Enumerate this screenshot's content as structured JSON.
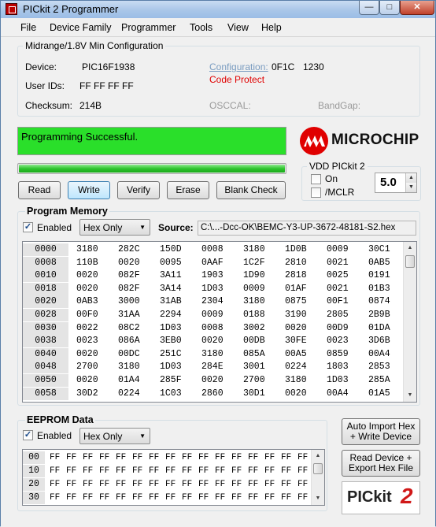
{
  "window": {
    "title": "PICkit 2 Programmer"
  },
  "menu": [
    "File",
    "Device Family",
    "Programmer",
    "Tools",
    "View",
    "Help"
  ],
  "config": {
    "group_title": "Midrange/1.8V Min Configuration",
    "device_label": "Device:",
    "device_value": "PIC16F1938",
    "userids_label": "User IDs:",
    "userids_value": "FF FF FF FF",
    "checksum_label": "Checksum:",
    "checksum_value": "214B",
    "configuration_label": "Configuration:",
    "configuration_values": [
      "0F1C",
      "1230"
    ],
    "code_protect": "Code Protect",
    "osccal_label": "OSCCAL:",
    "bandgap_label": "BandGap:"
  },
  "status": {
    "message": "Programming Successful.",
    "status_color": "#2adf2a",
    "progress": 1.0
  },
  "actions": [
    "Read",
    "Write",
    "Verify",
    "Erase",
    "Blank Check"
  ],
  "logo": {
    "text": "MICROCHIP",
    "brand_color": "#e00000"
  },
  "vdd": {
    "group_title": "VDD PICkit 2",
    "on_label": "On",
    "mclr_label": "/MCLR",
    "voltage": "5.0"
  },
  "program_memory": {
    "title": "Program Memory",
    "enabled_label": "Enabled",
    "mode": "Hex Only",
    "source_label": "Source:",
    "source_value": "C:\\...-Dcc-OK\\BEMC-Y3-UP-3672-48181-S2.hex",
    "rows": [
      {
        "addr": "0000",
        "cells": [
          "3180",
          "282C",
          "150D",
          "0008",
          "3180",
          "1D0B",
          "0009",
          "30C1"
        ]
      },
      {
        "addr": "0008",
        "cells": [
          "110B",
          "0020",
          "0095",
          "0AAF",
          "1C2F",
          "2810",
          "0021",
          "0AB5"
        ]
      },
      {
        "addr": "0010",
        "cells": [
          "0020",
          "082F",
          "3A11",
          "1903",
          "1D90",
          "2818",
          "0025",
          "0191"
        ]
      },
      {
        "addr": "0018",
        "cells": [
          "0020",
          "082F",
          "3A14",
          "1D03",
          "0009",
          "01AF",
          "0021",
          "01B3"
        ]
      },
      {
        "addr": "0020",
        "cells": [
          "0AB3",
          "3000",
          "31AB",
          "2304",
          "3180",
          "0875",
          "00F1",
          "0874"
        ]
      },
      {
        "addr": "0028",
        "cells": [
          "00F0",
          "31AA",
          "2294",
          "0009",
          "0188",
          "3190",
          "2805",
          "2B9B"
        ]
      },
      {
        "addr": "0030",
        "cells": [
          "0022",
          "08C2",
          "1D03",
          "0008",
          "3002",
          "0020",
          "00D9",
          "01DA"
        ]
      },
      {
        "addr": "0038",
        "cells": [
          "0023",
          "086A",
          "3EB0",
          "0020",
          "00DB",
          "30FE",
          "0023",
          "3D6B"
        ]
      },
      {
        "addr": "0040",
        "cells": [
          "0020",
          "00DC",
          "251C",
          "3180",
          "085A",
          "00A5",
          "0859",
          "00A4"
        ]
      },
      {
        "addr": "0048",
        "cells": [
          "2700",
          "3180",
          "1D03",
          "284E",
          "3001",
          "0224",
          "1803",
          "2853"
        ]
      },
      {
        "addr": "0050",
        "cells": [
          "0020",
          "01A4",
          "285F",
          "0020",
          "2700",
          "3180",
          "1D03",
          "285A"
        ]
      },
      {
        "addr": "0058",
        "cells": [
          "30D2",
          "0224",
          "1C03",
          "2860",
          "30D1",
          "0020",
          "00A4",
          "01A5"
        ]
      }
    ]
  },
  "eeprom": {
    "title": "EEPROM Data",
    "enabled_label": "Enabled",
    "mode": "Hex Only",
    "rows": [
      {
        "addr": "00",
        "bytes": [
          "FF",
          "FF",
          "FF",
          "FF",
          "FF",
          "FF",
          "FF",
          "FF",
          "FF",
          "FF",
          "FF",
          "FF",
          "FF",
          "FF",
          "FF",
          "FF"
        ]
      },
      {
        "addr": "10",
        "bytes": [
          "FF",
          "FF",
          "FF",
          "FF",
          "FF",
          "FF",
          "FF",
          "FF",
          "FF",
          "FF",
          "FF",
          "FF",
          "FF",
          "FF",
          "FF",
          "FF"
        ]
      },
      {
        "addr": "20",
        "bytes": [
          "FF",
          "FF",
          "FF",
          "FF",
          "FF",
          "FF",
          "FF",
          "FF",
          "FF",
          "FF",
          "FF",
          "FF",
          "FF",
          "FF",
          "FF",
          "FF"
        ]
      },
      {
        "addr": "30",
        "bytes": [
          "FF",
          "FF",
          "FF",
          "FF",
          "FF",
          "FF",
          "FF",
          "FF",
          "FF",
          "FF",
          "FF",
          "FF",
          "FF",
          "FF",
          "FF",
          "FF"
        ]
      }
    ],
    "auto_import_label_1": "Auto Import Hex",
    "auto_import_label_2": "+ Write Device",
    "read_export_label_1": "Read Device +",
    "read_export_label_2": "Export Hex File"
  },
  "pk2_logo": {
    "text": "PICkit",
    "number": "2"
  }
}
